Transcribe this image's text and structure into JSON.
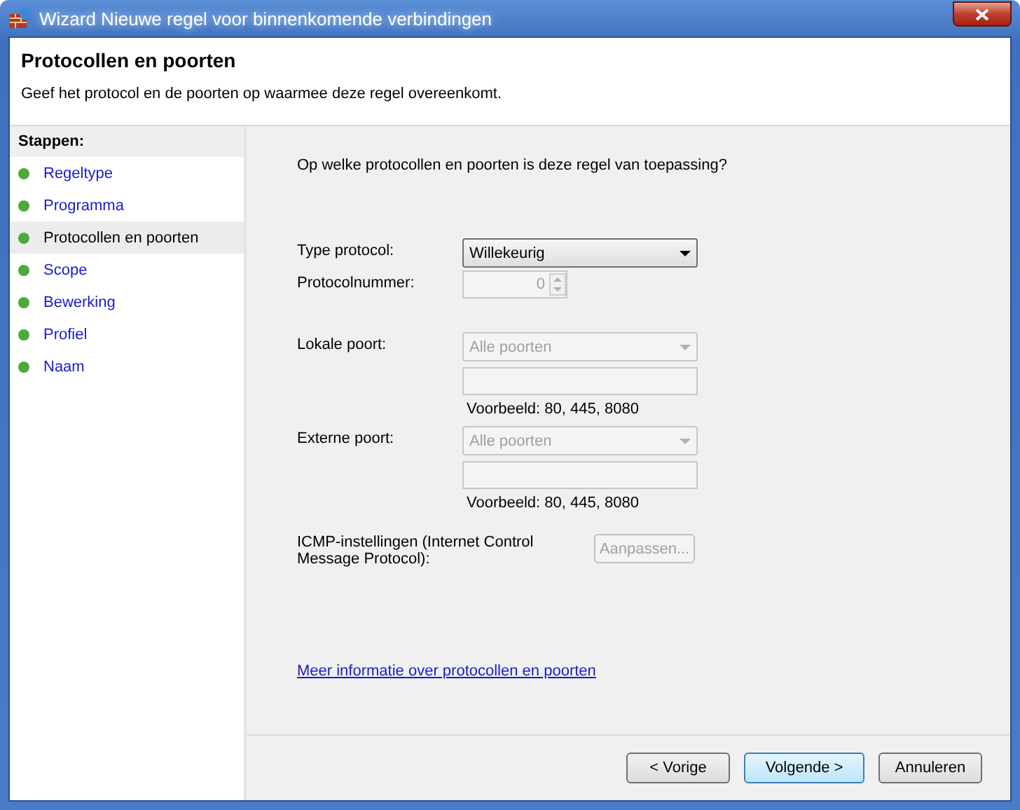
{
  "window": {
    "title": "Wizard Nieuwe regel voor binnenkomende verbindingen"
  },
  "header": {
    "title": "Protocollen en poorten",
    "subtitle": "Geef het protocol en de poorten op waarmee deze regel overeenkomt."
  },
  "steps": {
    "heading": "Stappen:",
    "items": [
      {
        "label": "Regeltype",
        "selected": false
      },
      {
        "label": "Programma",
        "selected": false
      },
      {
        "label": "Protocollen en poorten",
        "selected": true
      },
      {
        "label": "Scope",
        "selected": false
      },
      {
        "label": "Bewerking",
        "selected": false
      },
      {
        "label": "Profiel",
        "selected": false
      },
      {
        "label": "Naam",
        "selected": false
      }
    ]
  },
  "question": "Op welke protocollen en poorten is deze regel van toepassing?",
  "protocol": {
    "type_label": "Type protocol:",
    "type_value": "Willekeurig",
    "type_disabled": false,
    "number_label": "Protocolnummer:",
    "number_value": "0",
    "number_disabled": true
  },
  "ports": [
    {
      "label": "Lokale poort:",
      "value": "Alle poorten",
      "disabled": true,
      "example": "Voorbeeld: 80, 445, 8080"
    },
    {
      "label": "Externe poort:",
      "value": "Alle poorten",
      "disabled": true,
      "example": "Voorbeeld: 80, 445, 8080"
    }
  ],
  "icmp": {
    "label": "ICMP-instellingen (Internet Control Message Protocol):",
    "button": "Aanpassen...",
    "disabled": true
  },
  "link": "Meer informatie over protocollen en poorten",
  "buttons": [
    {
      "label": "< Vorige",
      "default": false
    },
    {
      "label": "Volgende >",
      "default": true
    },
    {
      "label": "Annuleren",
      "default": false
    }
  ]
}
